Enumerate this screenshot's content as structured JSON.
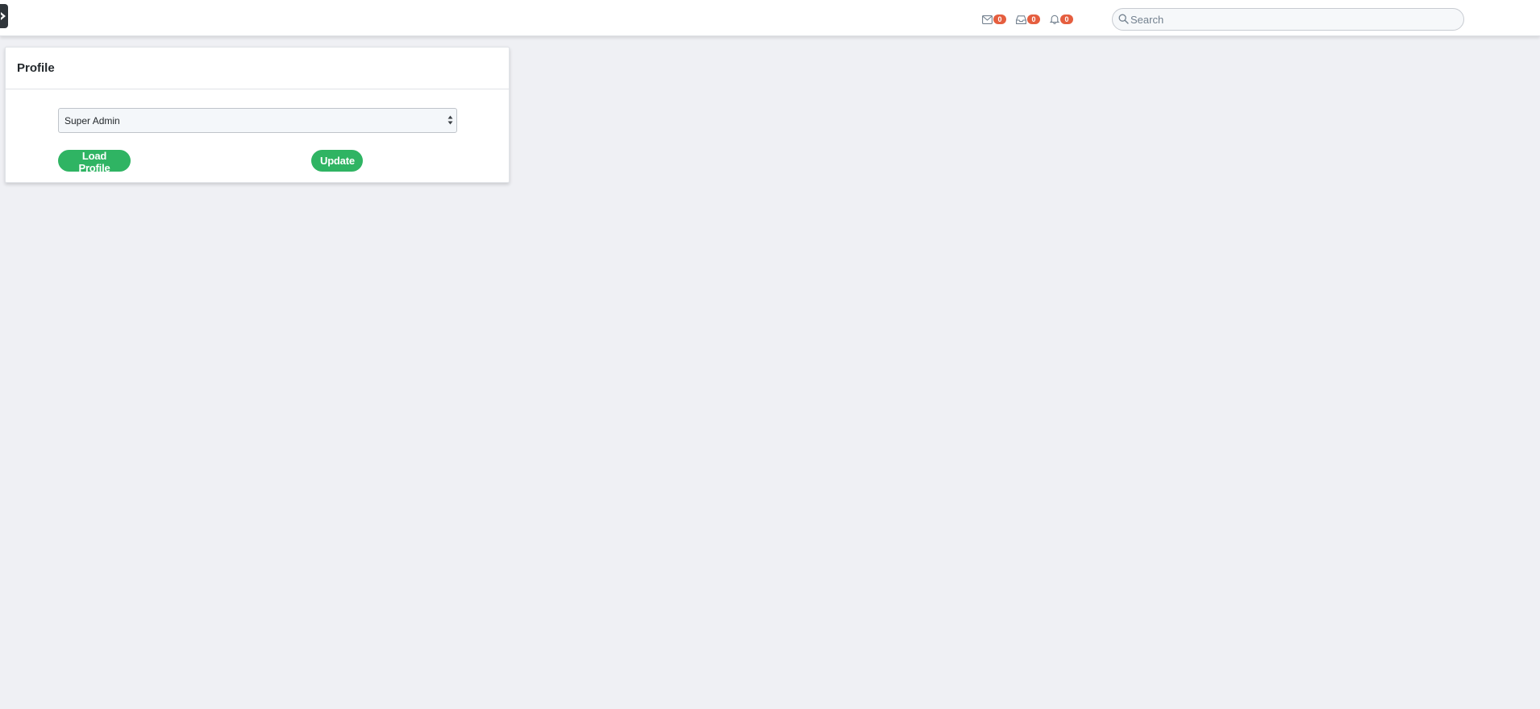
{
  "colors": {
    "badge": "#e55e3f",
    "button": "#2fb463",
    "page_background": "#eff0f4",
    "toggle": "#2f353a"
  },
  "topbar": {
    "sidebar_toggle_icon": "chevron-right-icon",
    "nav_items": [
      {
        "icon": "envelope-icon",
        "badge": "0"
      },
      {
        "icon": "inbox-tray-icon",
        "badge": "0"
      },
      {
        "icon": "bell-icon",
        "badge": "0"
      }
    ],
    "search": {
      "icon": "search-icon",
      "placeholder": "Search",
      "value": ""
    }
  },
  "profile_card": {
    "title": "Profile",
    "select": {
      "selected": "Super Admin",
      "icon": "select-arrows-icon"
    },
    "load_button_label": "Load Profile",
    "update_button_label": "Update"
  }
}
